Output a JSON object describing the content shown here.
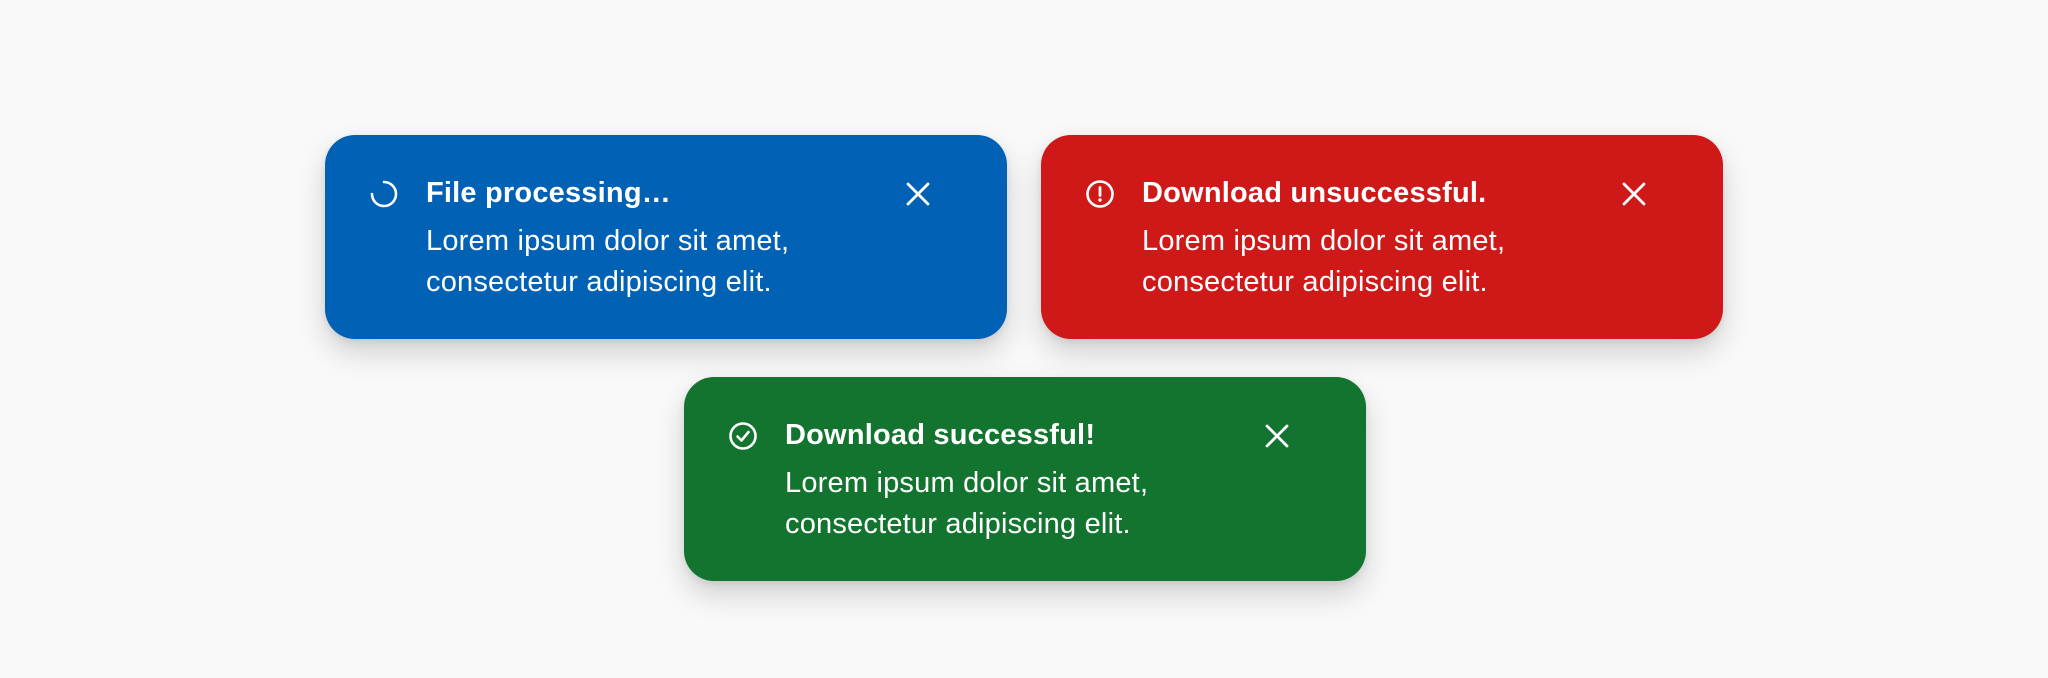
{
  "colors": {
    "page_background": "#f9f9f9",
    "info": "#0061b5",
    "error": "#cf1818",
    "success": "#13742f",
    "text": "#ffffff"
  },
  "toasts": [
    {
      "kind": "info",
      "icon": "spinner-icon",
      "title": "File processing…",
      "body_line1": "Lorem ipsum dolor sit amet,",
      "body_line2": "consectetur adipiscing elit.",
      "close_icon": "close-icon"
    },
    {
      "kind": "error",
      "icon": "alert-circle-icon",
      "title": "Download unsuccessful.",
      "body_line1": "Lorem ipsum dolor sit amet,",
      "body_line2": "consectetur adipiscing elit.",
      "close_icon": "close-icon"
    },
    {
      "kind": "success",
      "icon": "check-circle-icon",
      "title": "Download successful!",
      "body_line1": "Lorem ipsum dolor sit amet,",
      "body_line2": "consectetur adipiscing elit.",
      "close_icon": "close-icon"
    }
  ]
}
